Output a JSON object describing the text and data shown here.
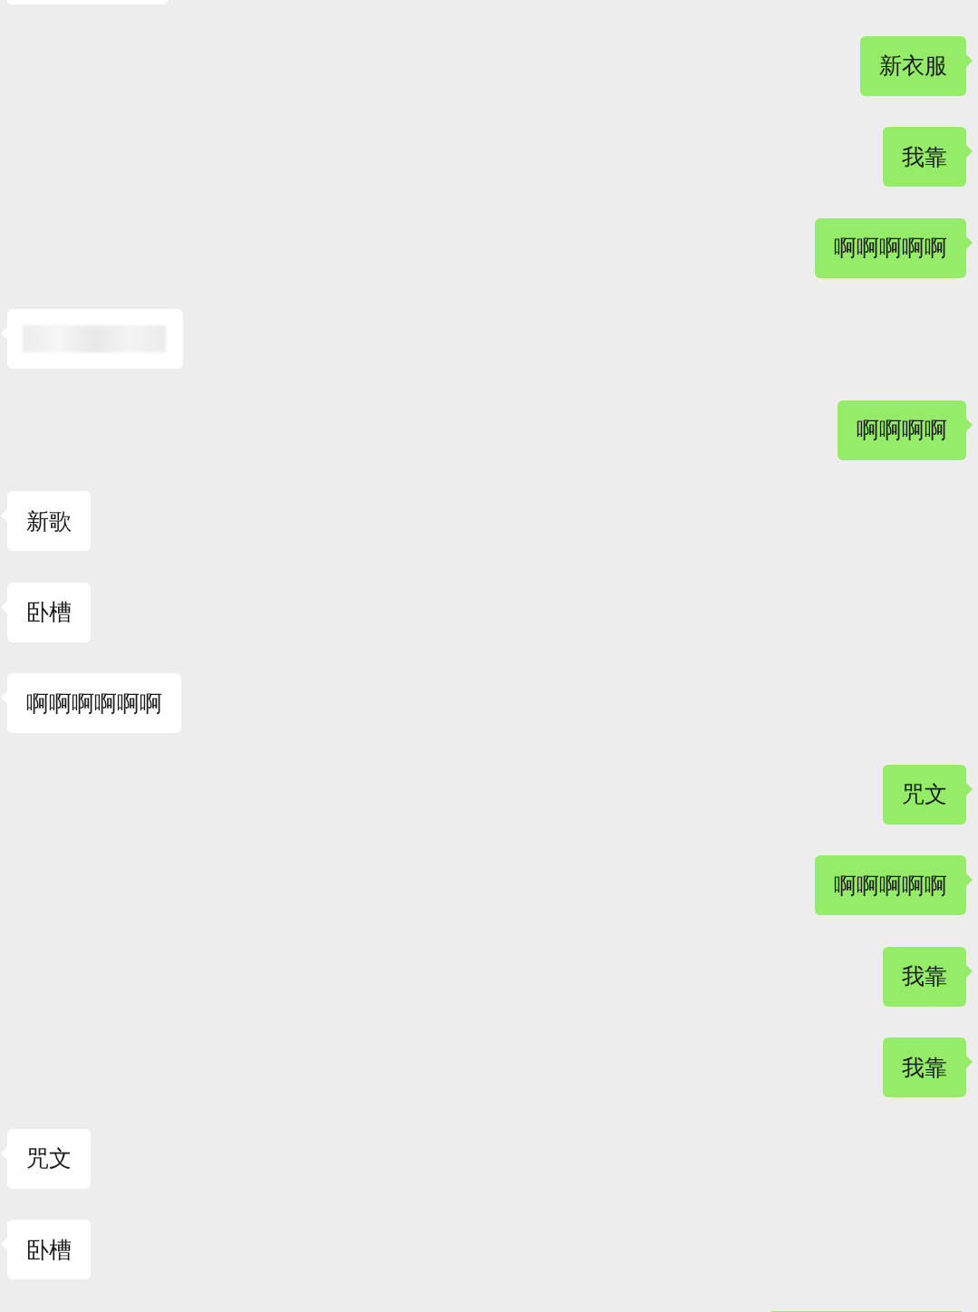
{
  "chat": {
    "messages": [
      {
        "outgoing": false,
        "kind": "clipped"
      },
      {
        "outgoing": true,
        "kind": "text",
        "text": "新衣服"
      },
      {
        "outgoing": true,
        "kind": "text",
        "text": "我靠"
      },
      {
        "outgoing": true,
        "kind": "text",
        "text": "啊啊啊啊啊"
      },
      {
        "outgoing": false,
        "kind": "redacted"
      },
      {
        "outgoing": true,
        "kind": "text",
        "text": "啊啊啊啊"
      },
      {
        "outgoing": false,
        "kind": "text",
        "text": "新歌"
      },
      {
        "outgoing": false,
        "kind": "text",
        "text": "卧槽"
      },
      {
        "outgoing": false,
        "kind": "text",
        "text": "啊啊啊啊啊啊"
      },
      {
        "outgoing": true,
        "kind": "text",
        "text": "咒文"
      },
      {
        "outgoing": true,
        "kind": "text",
        "text": "啊啊啊啊啊"
      },
      {
        "outgoing": true,
        "kind": "text",
        "text": "我靠"
      },
      {
        "outgoing": true,
        "kind": "text",
        "text": "我靠"
      },
      {
        "outgoing": false,
        "kind": "text",
        "text": "咒文"
      },
      {
        "outgoing": false,
        "kind": "text",
        "text": "卧槽"
      },
      {
        "outgoing": true,
        "kind": "clipped"
      }
    ]
  }
}
